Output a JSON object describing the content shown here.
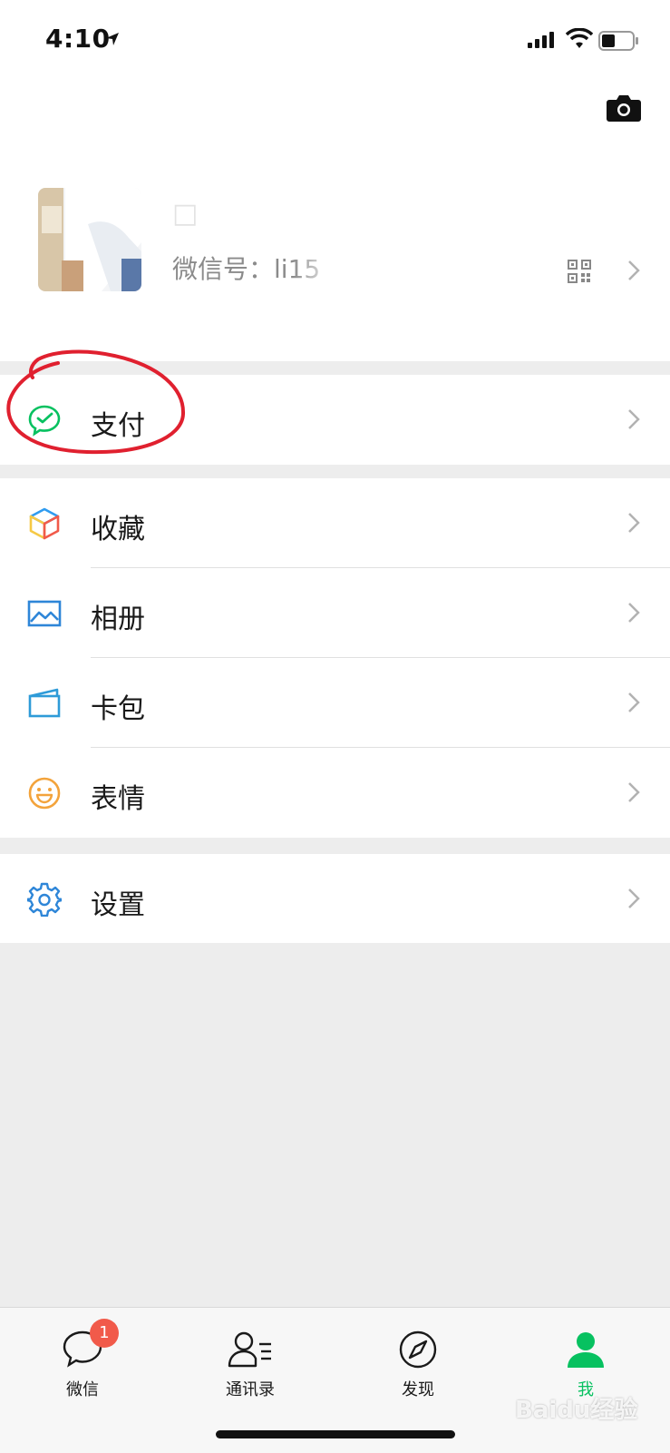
{
  "status_bar": {
    "time": "4:10"
  },
  "profile": {
    "nickname": "□",
    "wechat_id_label": "微信号：",
    "wechat_id_value": "li15"
  },
  "menu": {
    "pay": {
      "label": "支付",
      "icon": "wechat-pay-icon"
    },
    "favorites": {
      "label": "收藏",
      "icon": "favorites-cube-icon"
    },
    "album": {
      "label": "相册",
      "icon": "album-picture-icon"
    },
    "cards": {
      "label": "卡包",
      "icon": "card-wallet-icon"
    },
    "stickers": {
      "label": "表情",
      "icon": "smiley-icon"
    },
    "settings": {
      "label": "设置",
      "icon": "gear-icon"
    }
  },
  "tabbar": {
    "chats": {
      "label": "微信",
      "badge": "1"
    },
    "contacts": {
      "label": "通讯录"
    },
    "discover": {
      "label": "发现"
    },
    "me": {
      "label": "我"
    }
  },
  "watermark": {
    "text": "Baidu经验"
  },
  "colors": {
    "accent": "#07c160",
    "badge": "#f15a4a",
    "annotation": "#e0202f"
  }
}
